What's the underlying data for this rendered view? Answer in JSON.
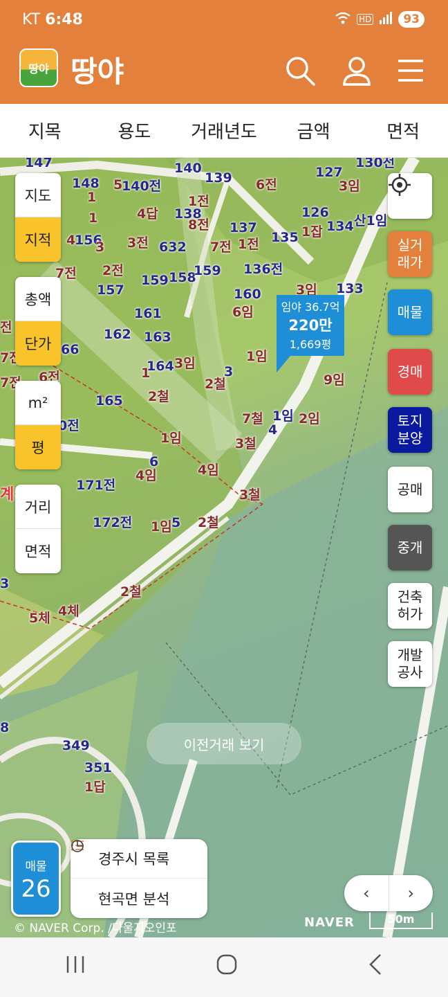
{
  "status": {
    "carrier": "KT",
    "time": "6:48",
    "hd": "HD",
    "battery": "93"
  },
  "header": {
    "logo_badge": "땅야",
    "title": "땅야"
  },
  "tabs": [
    "지목",
    "용도",
    "거래년도",
    "금액",
    "면적"
  ],
  "map_controls": {
    "layer": [
      {
        "label": "지도",
        "active": false
      },
      {
        "label": "지적",
        "active": true
      }
    ],
    "price": [
      {
        "label": "총액",
        "active": false
      },
      {
        "label": "단가",
        "active": true
      }
    ],
    "unit": [
      {
        "label": "m²",
        "active": false
      },
      {
        "label": "평",
        "active": true
      }
    ],
    "measure": [
      {
        "label": "거리",
        "active": false
      },
      {
        "label": "면적",
        "active": false
      }
    ]
  },
  "right_buttons": [
    {
      "label": "실거\n래가",
      "bg": "#E2803C",
      "fg": "#FFFFFF"
    },
    {
      "label": "매물",
      "bg": "#1E8FD6",
      "fg": "#FFFFFF"
    },
    {
      "label": "경매",
      "bg": "#E04A4A",
      "fg": "#FFFFFF"
    },
    {
      "label": "토지\n분양",
      "bg": "#0A1A9E",
      "fg": "#FFFFFF"
    },
    {
      "label": "공매",
      "bg": "#FFFFFF",
      "fg": "#222222"
    },
    {
      "label": "중개",
      "bg": "#555555",
      "fg": "#FFFFFF"
    },
    {
      "label": "건축\n허가",
      "bg": "#FFFFFF",
      "fg": "#222222"
    },
    {
      "label": "개발\n공사",
      "bg": "#FFFFFF",
      "fg": "#222222"
    }
  ],
  "listing_bubble": {
    "line1": "임야 36.7억",
    "line2": "220만",
    "line3": "1,669평"
  },
  "prev_deal_label": "이전거래 보기",
  "listing_count": {
    "label": "매물",
    "value": "26"
  },
  "quick_panel": {
    "list_label": "경주시 목록",
    "analysis_label": "현곡면 분석"
  },
  "copyright": "© NAVER Corp. /다울지오인포",
  "map_brand": "NAVER",
  "scale_label": "50m",
  "colors": {
    "brand": "#E2803C",
    "active_toggle": "#F9C32B",
    "listing_blue": "#1E8FD6"
  }
}
